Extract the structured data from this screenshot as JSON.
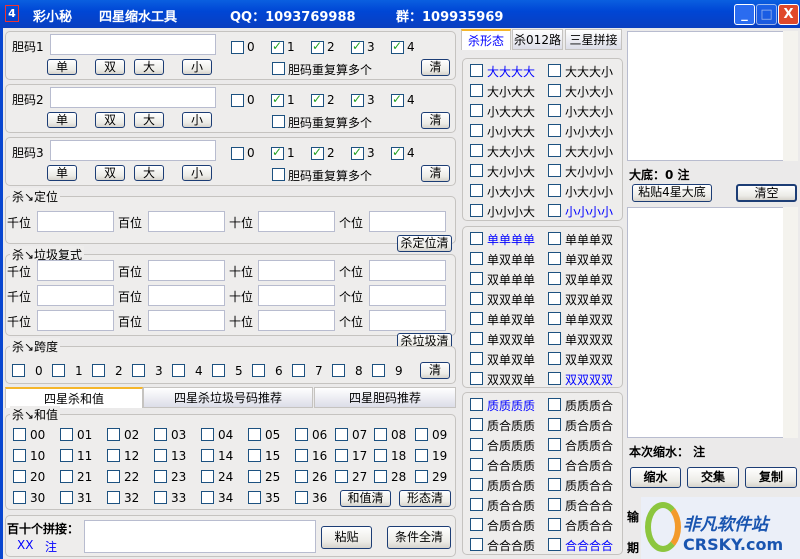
{
  "title": {
    "app": "彩小秘",
    "tool": "四星缩水工具",
    "qq": "QQ：1093769988",
    "group": "群：109935969",
    "icon": "4"
  },
  "window": {
    "minimize": "_",
    "maximize": "□",
    "close": "X"
  },
  "dan": [
    {
      "label": "胆码1",
      "value": "",
      "digits": [
        {
          "d": "0",
          "on": false
        },
        {
          "d": "1",
          "on": true
        },
        {
          "d": "2",
          "on": true
        },
        {
          "d": "3",
          "on": true
        },
        {
          "d": "4",
          "on": true
        }
      ]
    },
    {
      "label": "胆码2",
      "value": "",
      "digits": [
        {
          "d": "0",
          "on": false
        },
        {
          "d": "1",
          "on": true
        },
        {
          "d": "2",
          "on": true
        },
        {
          "d": "3",
          "on": true
        },
        {
          "d": "4",
          "on": true
        }
      ]
    },
    {
      "label": "胆码3",
      "value": "",
      "digits": [
        {
          "d": "0",
          "on": false
        },
        {
          "d": "1",
          "on": true
        },
        {
          "d": "2",
          "on": true
        },
        {
          "d": "3",
          "on": true
        },
        {
          "d": "4",
          "on": true
        }
      ]
    }
  ],
  "dan_buttons": [
    "单",
    "双",
    "大",
    "小"
  ],
  "dan_repeat": "胆码重复算多个",
  "clear": "清",
  "kill_position": {
    "legend": "杀↘定位",
    "labels": [
      "千位",
      "百位",
      "十位",
      "个位"
    ],
    "clear": "杀定位清"
  },
  "kill_garbage": {
    "legend": "杀↘垃圾复式",
    "labels": [
      "千位",
      "百位",
      "十位",
      "个位"
    ],
    "rows": 3,
    "clear": "杀垃圾清"
  },
  "kill_span": {
    "legend": "杀↘跨度",
    "digits": [
      "0",
      "1",
      "2",
      "3",
      "4",
      "5",
      "6",
      "7",
      "8",
      "9"
    ],
    "clear": "清"
  },
  "bottom_tabs": [
    {
      "label": "四星杀和值",
      "active": true
    },
    {
      "label": "四星杀垃圾号码推荐",
      "active": false
    },
    {
      "label": "四星胆码推荐",
      "active": false
    }
  ],
  "kill_sum": {
    "legend": "杀↘和值",
    "values": [
      "00",
      "01",
      "02",
      "03",
      "04",
      "05",
      "06",
      "07",
      "08",
      "09",
      "10",
      "11",
      "12",
      "13",
      "14",
      "15",
      "16",
      "17",
      "18",
      "19",
      "20",
      "21",
      "22",
      "23",
      "24",
      "25",
      "26",
      "27",
      "28",
      "29",
      "30",
      "31",
      "32",
      "33",
      "34",
      "35",
      "36"
    ],
    "sum_clear": "和值清",
    "shape_clear": "形态清"
  },
  "splice": {
    "label": "百十个拼接：",
    "count": "XX",
    "unit": "注",
    "paste": "粘贴",
    "clear_all": "条件全清"
  },
  "mid_tabs": [
    {
      "label": "杀形态",
      "active": true
    },
    {
      "label": "杀012路",
      "active": false
    },
    {
      "label": "三星拼接",
      "active": false
    }
  ],
  "shapes": [
    [
      {
        "t": "大大大大",
        "blue": true
      },
      {
        "t": "大大大小"
      },
      {
        "t": "大小大大"
      },
      {
        "t": "大小大小"
      },
      {
        "t": "小大大大"
      },
      {
        "t": "小大大小"
      },
      {
        "t": "小小大大"
      },
      {
        "t": "小小大小"
      },
      {
        "t": "大大小大"
      },
      {
        "t": "大大小小"
      },
      {
        "t": "大小小大"
      },
      {
        "t": "大小小小"
      },
      {
        "t": "小大小大"
      },
      {
        "t": "小大小小"
      },
      {
        "t": "小小小大"
      },
      {
        "t": "小小小小",
        "blue": true
      }
    ],
    [
      {
        "t": "单单单单",
        "blue": true
      },
      {
        "t": "单单单双"
      },
      {
        "t": "单双单单"
      },
      {
        "t": "单双单双"
      },
      {
        "t": "双单单单"
      },
      {
        "t": "双单单双"
      },
      {
        "t": "双双单单"
      },
      {
        "t": "双双单双"
      },
      {
        "t": "单单双单"
      },
      {
        "t": "单单双双"
      },
      {
        "t": "单双双单"
      },
      {
        "t": "单双双双"
      },
      {
        "t": "双单双单"
      },
      {
        "t": "双单双双"
      },
      {
        "t": "双双双单"
      },
      {
        "t": "双双双双",
        "blue": true
      }
    ],
    [
      {
        "t": "质质质质",
        "blue": true
      },
      {
        "t": "质质质合"
      },
      {
        "t": "质合质质"
      },
      {
        "t": "质合质合"
      },
      {
        "t": "合质质质"
      },
      {
        "t": "合质质合"
      },
      {
        "t": "合合质质"
      },
      {
        "t": "合合质合"
      },
      {
        "t": "质质合质"
      },
      {
        "t": "质质合合"
      },
      {
        "t": "质合合质"
      },
      {
        "t": "质合合合"
      },
      {
        "t": "合质合质"
      },
      {
        "t": "合质合合"
      },
      {
        "t": "合合合质"
      },
      {
        "t": "合合合合",
        "blue": true
      }
    ]
  ],
  "right": {
    "base_label": "大底：0 注",
    "paste_base": "粘贴4星大底",
    "clear": "清空",
    "shrink_label": "本次缩水：  注",
    "shrink": "缩水",
    "intersect": "交集",
    "copy": "复制",
    "issue_prefix": "输",
    "period_prefix": "期"
  },
  "watermark": {
    "cn": "非凡软件站",
    "en": "CRSKY.com"
  },
  "colors": {
    "titlebar": "#0046d5",
    "highlight": "#0000ff",
    "check": "#21a121"
  }
}
